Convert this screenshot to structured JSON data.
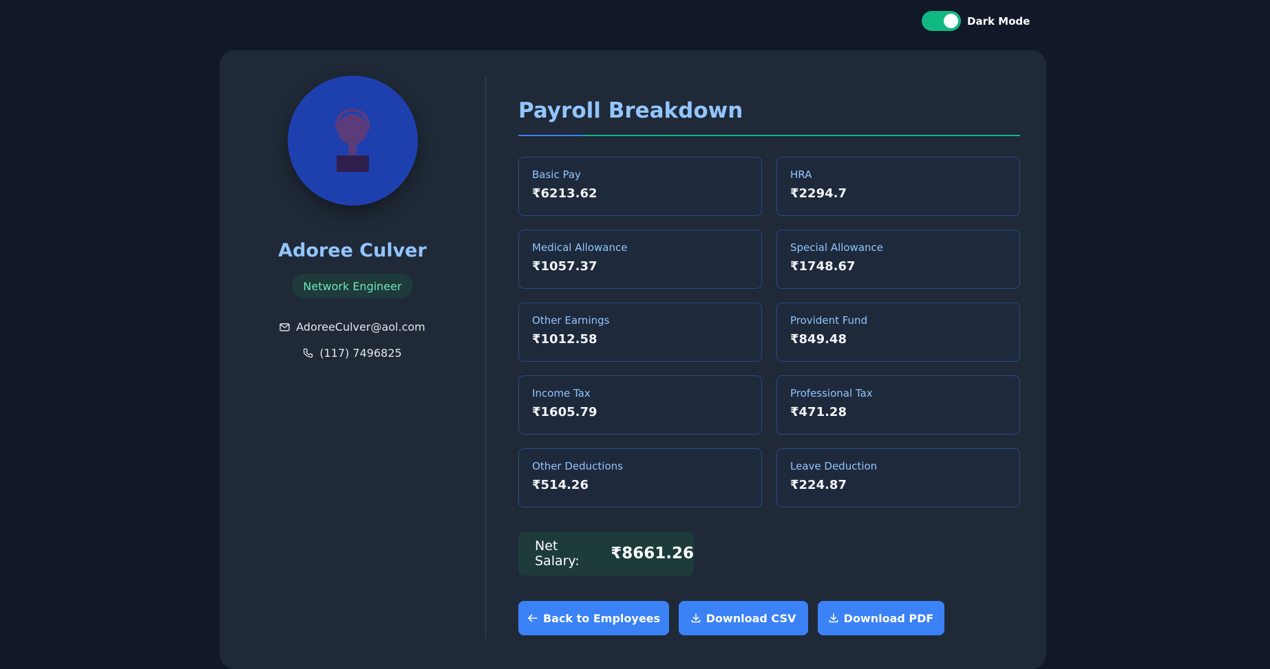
{
  "theme_toggle": {
    "label": "Dark Mode",
    "on": true
  },
  "profile": {
    "name": "Adoree Culver",
    "role": "Network Engineer",
    "email": "AdoreeCulver@aol.com",
    "phone": "(117) 7496825"
  },
  "payroll": {
    "title": "Payroll Breakdown",
    "items": [
      {
        "label": "Basic Pay",
        "value": "₹6213.62"
      },
      {
        "label": "HRA",
        "value": "₹2294.7"
      },
      {
        "label": "Medical Allowance",
        "value": "₹1057.37"
      },
      {
        "label": "Special Allowance",
        "value": "₹1748.67"
      },
      {
        "label": "Other Earnings",
        "value": "₹1012.58"
      },
      {
        "label": "Provident Fund",
        "value": "₹849.48"
      },
      {
        "label": "Income Tax",
        "value": "₹1605.79"
      },
      {
        "label": "Professional Tax",
        "value": "₹471.28"
      },
      {
        "label": "Other Deductions",
        "value": "₹514.26"
      },
      {
        "label": "Leave Deduction",
        "value": "₹224.87"
      }
    ],
    "net_label": "Net Salary:",
    "net_value": "₹8661.26"
  },
  "actions": {
    "back": "Back to Employees",
    "csv": "Download CSV",
    "pdf": "Download PDF"
  },
  "colors": {
    "background": "#111827",
    "card": "#1f2937",
    "accent": "#3b82f6",
    "success": "#10b981"
  }
}
